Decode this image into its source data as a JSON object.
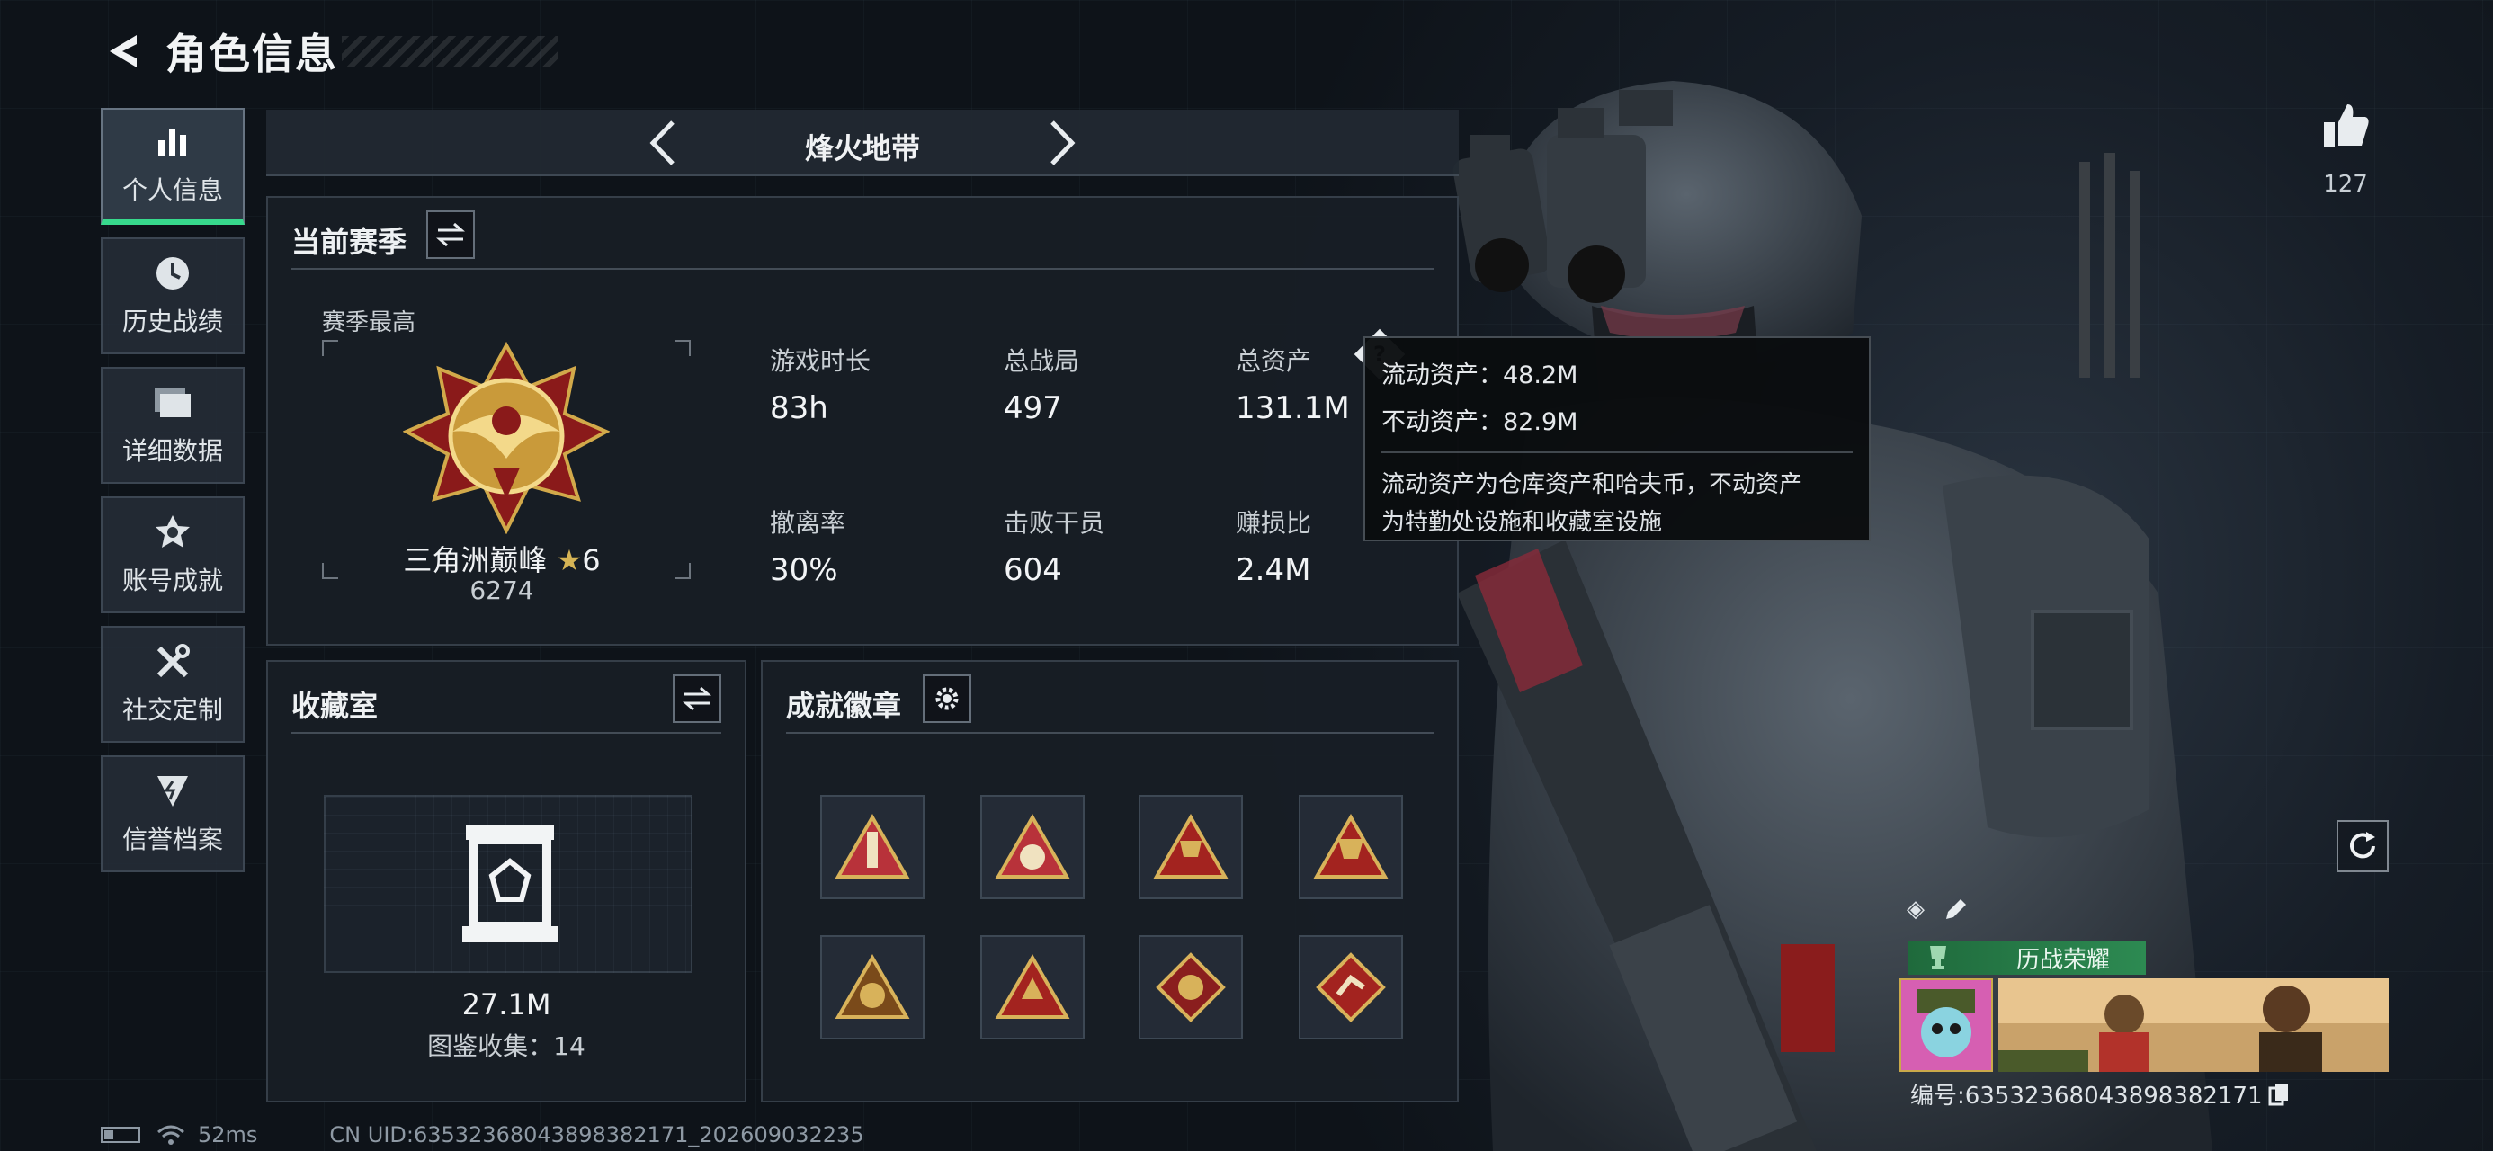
{
  "header": {
    "title": "角色信息"
  },
  "sidebar": {
    "items": [
      {
        "label": "个人信息",
        "icon": "bar-chart-icon",
        "active": true
      },
      {
        "label": "历史战绩",
        "icon": "clock-icon",
        "active": false
      },
      {
        "label": "详细数据",
        "icon": "folder-icon",
        "active": false
      },
      {
        "label": "账号成就",
        "icon": "medal-icon",
        "active": false
      },
      {
        "label": "社交定制",
        "icon": "tools-icon",
        "active": false
      },
      {
        "label": "信誉档案",
        "icon": "shield-icon",
        "active": false
      }
    ]
  },
  "mode": {
    "title": "烽火地带"
  },
  "season": {
    "title": "当前赛季",
    "subtitle": "赛季最高",
    "rank_name": "三角洲巅峰",
    "rank_stars": "6",
    "rank_score": "6274",
    "stats": [
      {
        "label": "游戏时长",
        "value": "83h"
      },
      {
        "label": "总战局",
        "value": "497"
      },
      {
        "label": "总资产",
        "value": "131.1M"
      },
      {
        "label": "撤离率",
        "value": "30%"
      },
      {
        "label": "击败干员",
        "value": "604"
      },
      {
        "label": "赚损比",
        "value": "2.4M"
      }
    ]
  },
  "tooltip": {
    "liquid": "流动资产：48.2M",
    "fixed": "不动资产：82.9M",
    "desc_line1": "流动资产为仓库资产和哈夫币，不动资产",
    "desc_line2": "为特勤处设施和收藏室设施"
  },
  "collection": {
    "title": "收藏室",
    "value": "27.1M",
    "count": "图鉴收集：14"
  },
  "achievements": {
    "title": "成就徽章",
    "badges": [
      "badge-1",
      "badge-2",
      "badge-3",
      "badge-4",
      "badge-5",
      "badge-6",
      "badge-7",
      "badge-8"
    ]
  },
  "likes": {
    "count": "127"
  },
  "card": {
    "honor_label": "历战荣耀",
    "id_text": "编号:635323680438983821​71"
  },
  "statusbar": {
    "ping": "52ms",
    "uid": "CN UID:635323680438983821​71_202609032235"
  },
  "colors": {
    "accent": "#37d98c",
    "gold": "#caa94a",
    "badge_red": "#a3231f"
  }
}
